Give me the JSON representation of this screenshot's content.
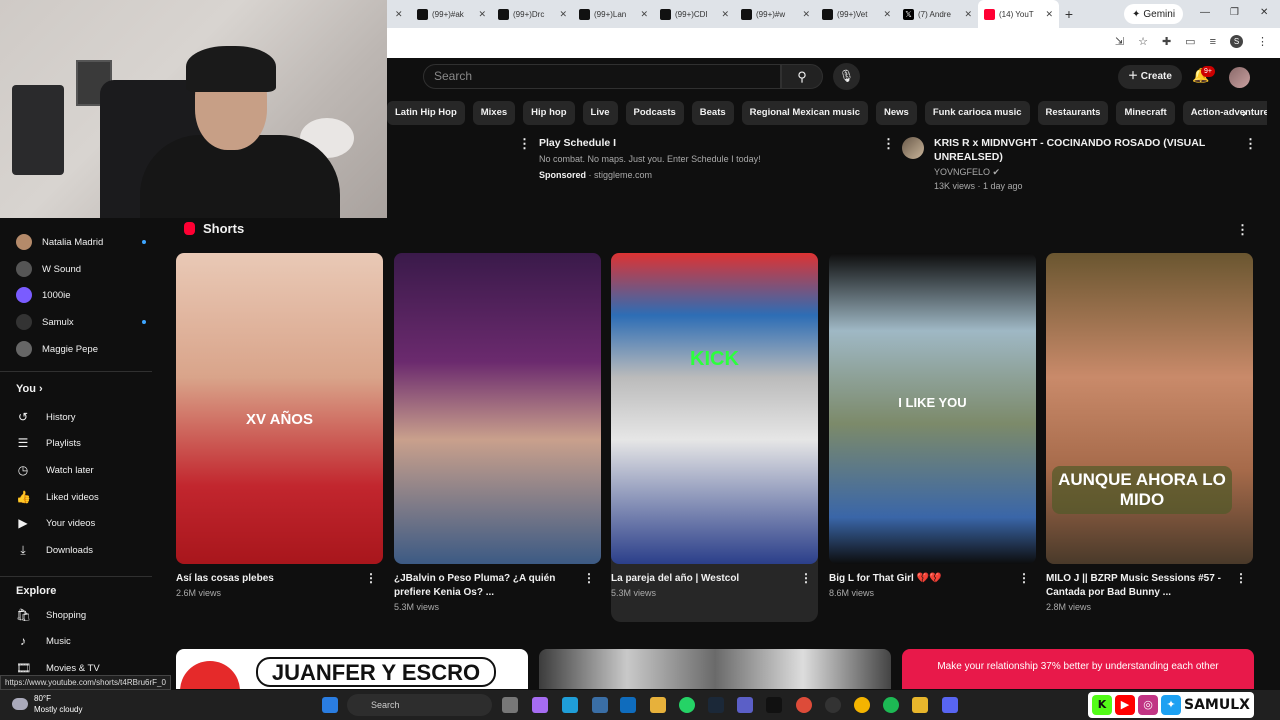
{
  "browser": {
    "tabs": [
      {
        "title": "(99+)#ak",
        "icon": "tiktok-icon"
      },
      {
        "title": "(99+)Drc",
        "icon": "tiktok-icon"
      },
      {
        "title": "(99+)Lan",
        "icon": "tiktok-icon"
      },
      {
        "title": "(99+)CDI",
        "icon": "tiktok-icon"
      },
      {
        "title": "(99+)#w",
        "icon": "tiktok-icon"
      },
      {
        "title": "(99+)Vet",
        "icon": "tiktok-icon"
      },
      {
        "title": "(7) Andre",
        "icon": "x-icon"
      },
      {
        "title": "(14) YouT",
        "icon": "youtube-icon"
      }
    ],
    "gemini_label": "Gemini",
    "profile_letter": "S"
  },
  "header": {
    "search_placeholder": "Search",
    "create_label": "Create",
    "notifications_badge": "9+"
  },
  "chips": [
    "Latin Hip Hop",
    "Mixes",
    "Hip hop",
    "Live",
    "Podcasts",
    "Beats",
    "Regional Mexican music",
    "News",
    "Funk carioca music",
    "Restaurants",
    "Minecraft",
    "Action-adventure gam"
  ],
  "top_row": {
    "ad": {
      "title": "Play Schedule I",
      "description": "No combat. No maps. Just you. Enter Schedule I today!",
      "sponsored": "Sponsored",
      "domain": "· stiggleme.com"
    },
    "video": {
      "title": "KRIS R x MIDNVGHT - COCINANDO ROSADO (VISUAL UNREALSED)",
      "channel": "YOVNGFELO",
      "meta": "13K views · 1 day ago"
    }
  },
  "sidebar": {
    "subscriptions": [
      {
        "name": "Natalia Madrid",
        "live": true,
        "color": "#b48a6a"
      },
      {
        "name": "W Sound",
        "live": false,
        "color": "#555"
      },
      {
        "name": "1000ie",
        "live": false,
        "color": "#7a5cff"
      },
      {
        "name": "Samulx",
        "live": true,
        "color": "#333"
      },
      {
        "name": "Maggie Pepe",
        "live": false,
        "color": "#666"
      }
    ],
    "you_label": "You",
    "you_items": [
      {
        "label": "History",
        "icon": "history-icon"
      },
      {
        "label": "Playlists",
        "icon": "playlists-icon"
      },
      {
        "label": "Watch later",
        "icon": "watch-later-icon"
      },
      {
        "label": "Liked videos",
        "icon": "like-icon"
      },
      {
        "label": "Your videos",
        "icon": "your-videos-icon"
      },
      {
        "label": "Downloads",
        "icon": "download-icon"
      }
    ],
    "explore_label": "Explore",
    "explore_items": [
      {
        "label": "Shopping",
        "icon": "shopping-icon"
      },
      {
        "label": "Music",
        "icon": "music-icon"
      },
      {
        "label": "Movies & TV",
        "icon": "movies-icon"
      }
    ]
  },
  "shorts": {
    "title": "Shorts",
    "items": [
      {
        "title": "Así las cosas plebes",
        "views": "2.6M views",
        "overlay": "XV AÑOS"
      },
      {
        "title": "¿JBalvin o Peso Pluma? ¿A quién prefiere Kenia Os? ...",
        "views": "5.3M views",
        "overlay": ""
      },
      {
        "title": "La pareja del año | Westcol",
        "views": "5.3M views",
        "overlay": "KICK"
      },
      {
        "title": "Big L for That Girl 💔💔",
        "views": "8.6M views",
        "overlay": "I LIKE YOU"
      },
      {
        "title": "MILO J || BZRP Music Sessions #57 - Cantada por Bad Bunny ...",
        "views": "2.8M views",
        "overlay": "AUNQUE AHORA LO MIDO"
      }
    ]
  },
  "bottom_row": {
    "card1": "JUANFER Y ESCRO",
    "card3": "Make your relationship 37% better by understanding each other"
  },
  "status_url": "https://www.youtube.com/shorts/t4RBru6rF_0",
  "taskbar": {
    "weather_temp": "80°F",
    "weather_desc": "Mostly cloudy",
    "search_label": "Search",
    "overlay_name": "SAMULX"
  }
}
